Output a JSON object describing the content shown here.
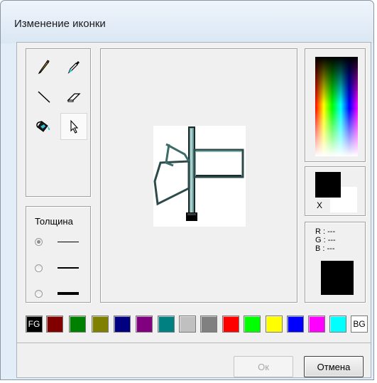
{
  "window": {
    "title": "Изменение иконки"
  },
  "tools": [
    {
      "name": "pencil",
      "icon": "pencil-icon"
    },
    {
      "name": "eyedropper",
      "icon": "eyedropper-icon"
    },
    {
      "name": "line",
      "icon": "line-icon"
    },
    {
      "name": "eraser",
      "icon": "eraser-icon"
    },
    {
      "name": "fill",
      "icon": "paint-bucket-icon"
    },
    {
      "name": "select",
      "icon": "cursor-icon",
      "selected": true
    }
  ],
  "thickness": {
    "title": "Толщина",
    "options": [
      {
        "level": 1,
        "checked": true
      },
      {
        "level": 2,
        "checked": false
      },
      {
        "level": 3,
        "checked": false
      }
    ]
  },
  "color": {
    "x_label": "X",
    "r_label": "R : ---",
    "g_label": "G : ---",
    "b_label": "B : ---",
    "foreground": "#000000",
    "background": "#ffffff"
  },
  "palette": {
    "fg_label": "FG",
    "bg_label": "BG",
    "colors": [
      "#800000",
      "#008000",
      "#808000",
      "#000080",
      "#800080",
      "#008080",
      "#c0c0c0",
      "#808080",
      "#ff0000",
      "#00ff00",
      "#ffff00",
      "#0000ff",
      "#ff00ff",
      "#00ffff"
    ]
  },
  "buttons": {
    "ok": "Ок",
    "cancel": "Отмена"
  }
}
